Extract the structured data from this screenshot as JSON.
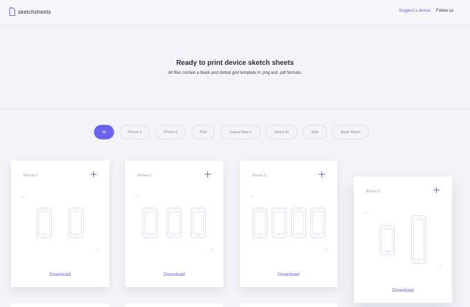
{
  "header": {
    "logo_text": "sketchsheets",
    "suggest_label": "Suggest a device",
    "follow_label": "Follow us"
  },
  "hero": {
    "title": "Ready to print device sketch sheets",
    "subtitle": "All files contain a blank and dotted grid template in .png and .pdf formats."
  },
  "filters": [
    "All",
    "iPhone 5",
    "iPhone 6",
    "iPad",
    "Galaxy Note 5",
    "Nexus 5x",
    "Web",
    "Apple Watch"
  ],
  "cards": [
    {
      "title": "iPhone 5",
      "download_label": "Download"
    },
    {
      "title": "iPhone 5",
      "download_label": "Download"
    },
    {
      "title": "iPhone 5",
      "download_label": "Download"
    },
    {
      "title": "iPhone 5",
      "download_label": "Download"
    }
  ],
  "colors": {
    "accent": "#6b63e6",
    "background": "#f3f4f9"
  }
}
